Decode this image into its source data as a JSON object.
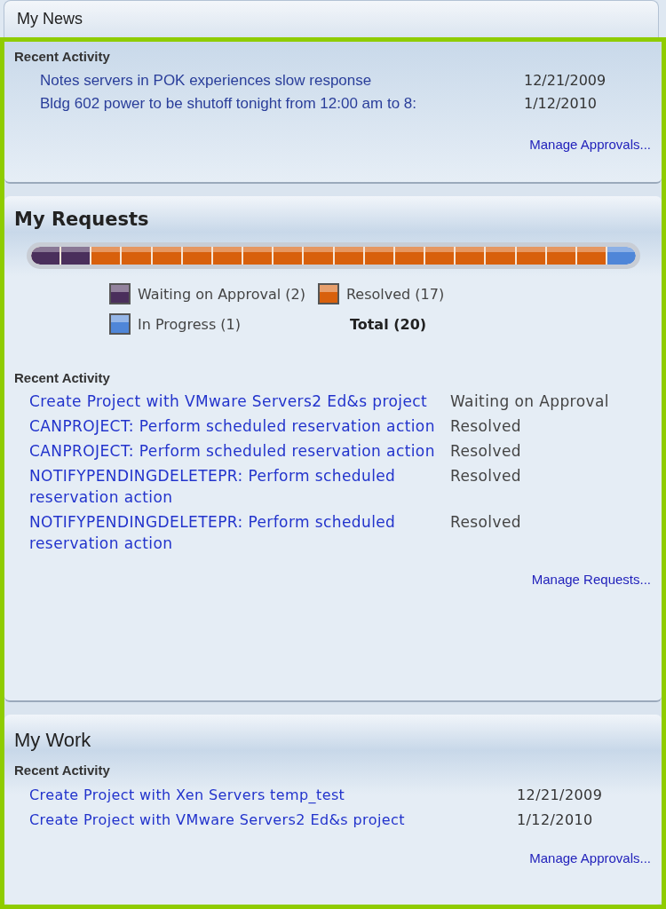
{
  "news": {
    "title": "My News",
    "section": "Recent Activity",
    "items": [
      {
        "text": "Notes servers in POK experiences slow response",
        "date": "12/21/2009"
      },
      {
        "text": "Bldg 602 power to be shutoff tonight from 12:00 am to 8:",
        "date": "1/12/2010"
      }
    ],
    "link": "Manage Approvals..."
  },
  "requests": {
    "title": "My Requests",
    "bar": [
      {
        "color": "#4a2f5c"
      },
      {
        "color": "#4a2f5c"
      },
      {
        "color": "#d8600c"
      },
      {
        "color": "#d8600c"
      },
      {
        "color": "#d8600c"
      },
      {
        "color": "#d8600c"
      },
      {
        "color": "#d8600c"
      },
      {
        "color": "#d8600c"
      },
      {
        "color": "#d8600c"
      },
      {
        "color": "#d8600c"
      },
      {
        "color": "#d8600c"
      },
      {
        "color": "#d8600c"
      },
      {
        "color": "#d8600c"
      },
      {
        "color": "#d8600c"
      },
      {
        "color": "#d8600c"
      },
      {
        "color": "#d8600c"
      },
      {
        "color": "#d8600c"
      },
      {
        "color": "#d8600c"
      },
      {
        "color": "#d8600c"
      },
      {
        "color": "#4f86d8"
      }
    ],
    "legend": [
      {
        "label": "Waiting on Approval (2)",
        "color": "#4a2f5c"
      },
      {
        "label": "Resolved (17)",
        "color": "#d8600c"
      },
      {
        "label": "In Progress (1)",
        "color": "#4f86d8"
      }
    ],
    "total": "Total (20)",
    "section": "Recent Activity",
    "items": [
      {
        "text": "Create Project with VMware Servers2 Ed&s project",
        "status": "Waiting on Approval"
      },
      {
        "text": "CANPROJECT: Perform scheduled reservation action",
        "status": "Resolved"
      },
      {
        "text": "CANPROJECT: Perform scheduled reservation action",
        "status": "Resolved"
      },
      {
        "text": "NOTIFYPENDINGDELETEPR: Perform scheduled reservation action",
        "status": "Resolved"
      },
      {
        "text": "NOTIFYPENDINGDELETEPR: Perform scheduled reservation action",
        "status": "Resolved"
      }
    ],
    "link": "Manage Requests..."
  },
  "work": {
    "title": "My Work",
    "section": "Recent Activity",
    "items": [
      {
        "text": "Create Project with Xen Servers temp_test",
        "date": "12/21/2009"
      },
      {
        "text": "Create Project with VMware Servers2 Ed&s project",
        "date": "1/12/2010"
      }
    ],
    "link": "Manage Approvals..."
  }
}
